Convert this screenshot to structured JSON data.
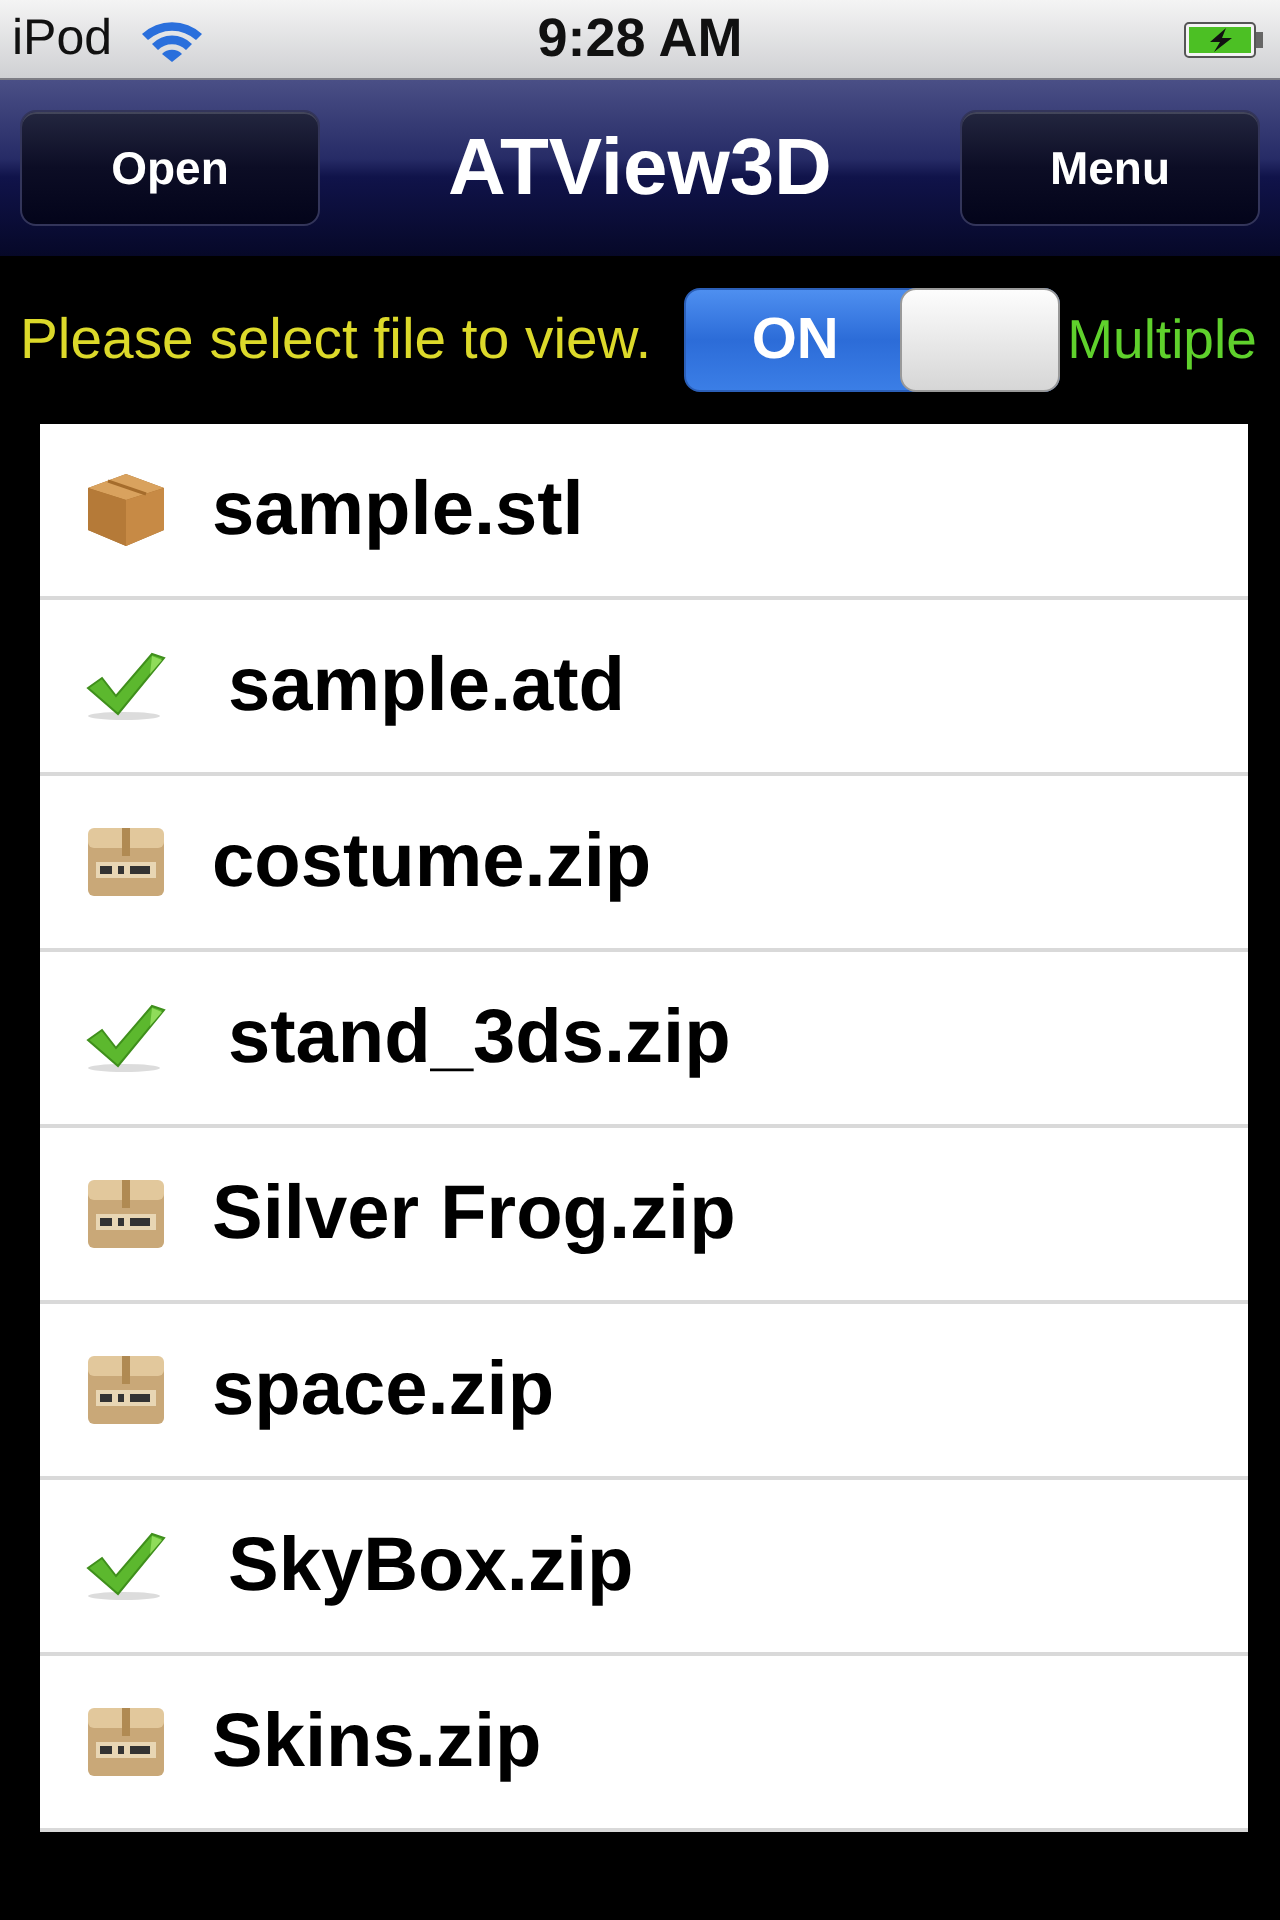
{
  "status_bar": {
    "carrier": "iPod",
    "time": "9:28 AM"
  },
  "nav_bar": {
    "left_button": "Open",
    "title": "ATView3D",
    "right_button": "Menu"
  },
  "selection_bar": {
    "prompt": "Please select file to view.",
    "toggle": {
      "label": "ON",
      "on": true
    },
    "toggle_caption": "Multiple"
  },
  "files": [
    {
      "name": "sample.stl",
      "kind": "model",
      "selected": false
    },
    {
      "name": "sample.atd",
      "selected": true
    },
    {
      "name": "costume.zip",
      "kind": "zip",
      "selected": false
    },
    {
      "name": "stand_3ds.zip",
      "selected": true
    },
    {
      "name": "Silver Frog.zip",
      "kind": "zip",
      "selected": false
    },
    {
      "name": "space.zip",
      "kind": "zip",
      "selected": false
    },
    {
      "name": "SkyBox.zip",
      "selected": true
    },
    {
      "name": "Skins.zip",
      "kind": "zip",
      "selected": false
    }
  ]
}
